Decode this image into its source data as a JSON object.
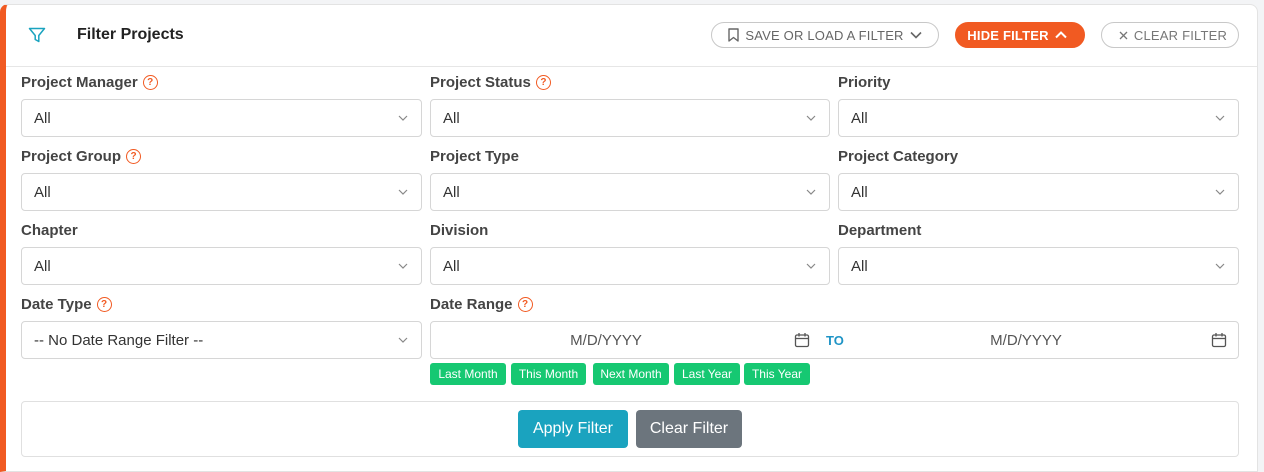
{
  "header": {
    "title": "Filter Projects",
    "save_load_label": "SAVE OR LOAD A FILTER",
    "hide_filter_label": "HIDE FILTER",
    "clear_filter_label": "CLEAR FILTER"
  },
  "fields": [
    {
      "label": "Project Manager",
      "value": "All",
      "help": "?"
    },
    {
      "label": "Project Status",
      "value": "All",
      "help": "?"
    },
    {
      "label": "Priority",
      "value": "All"
    },
    {
      "label": "Project Group",
      "value": "All",
      "help": "?"
    },
    {
      "label": "Project Type",
      "value": "All"
    },
    {
      "label": "Project Category",
      "value": "All"
    },
    {
      "label": "Chapter",
      "value": "All"
    },
    {
      "label": "Division",
      "value": "All"
    },
    {
      "label": "Department",
      "value": "All"
    },
    {
      "label": "Date Type",
      "value": "-- No Date Range Filter --",
      "help": "?"
    }
  ],
  "date_range": {
    "label": "Date Range",
    "help": "?",
    "from_placeholder": "M/D/YYYY",
    "to_label": "TO",
    "to_placeholder": "M/D/YYYY",
    "quick_ranges": [
      "Last Month",
      "This Month",
      "Next Month",
      "Last Year",
      "This Year"
    ]
  },
  "footer": {
    "apply_label": "Apply Filter",
    "clear_label": "Clear Filter"
  },
  "colors": {
    "accent": "#f15a22",
    "quick_range": "#16c872",
    "apply": "#1aa3bf",
    "clear": "#6c757d",
    "to_label": "#1f94c6"
  }
}
